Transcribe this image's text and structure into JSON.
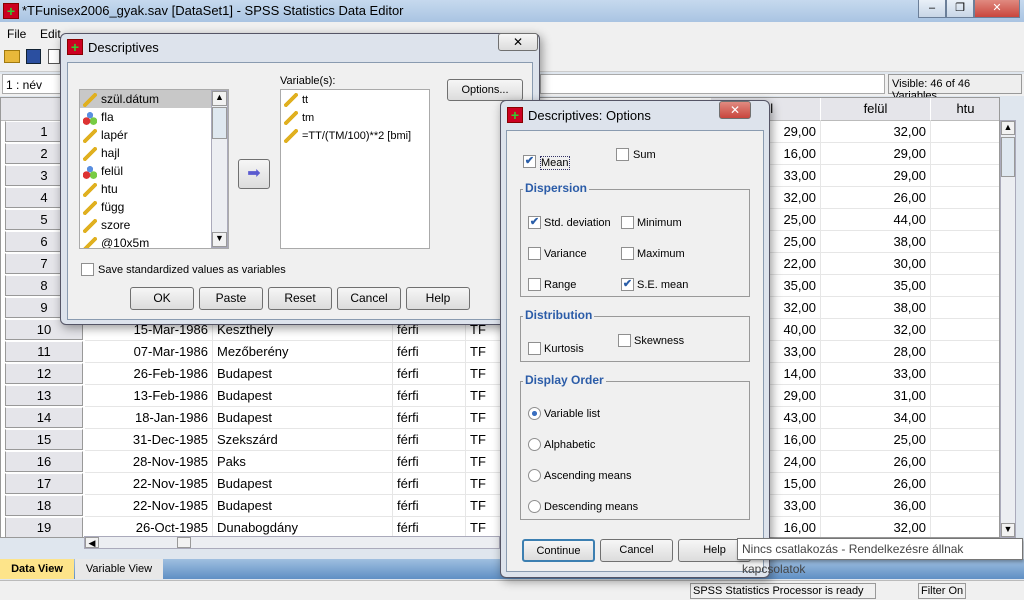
{
  "window": {
    "title": "*TFunisex2006_gyak.sav [DataSet1] - SPSS Statistics Data Editor",
    "minimize": "–",
    "restore": "❐",
    "close": "✕"
  },
  "menu": [
    {
      "label": "File"
    },
    {
      "label": "Edit"
    }
  ],
  "cell_ref": "1 : név",
  "visible_vars": "Visible: 46 of 46 Variables",
  "grid": {
    "headers": [
      "ül",
      "felül",
      "htu"
    ],
    "row_numbers": [
      "1",
      "2",
      "3",
      "4",
      "5",
      "6",
      "7",
      "8",
      "9",
      "10",
      "11",
      "12",
      "13",
      "14",
      "15",
      "16",
      "17",
      "18",
      "19"
    ],
    "right_cols": [
      [
        "29,00",
        "32,00"
      ],
      [
        "16,00",
        "29,00"
      ],
      [
        "33,00",
        "29,00"
      ],
      [
        "32,00",
        "26,00"
      ],
      [
        "25,00",
        "44,00"
      ],
      [
        "25,00",
        "38,00"
      ],
      [
        "22,00",
        "30,00"
      ],
      [
        "35,00",
        "35,00"
      ],
      [
        "32,00",
        "38,00"
      ],
      [
        "40,00",
        "32,00"
      ],
      [
        "33,00",
        "28,00"
      ],
      [
        "14,00",
        "33,00"
      ],
      [
        "29,00",
        "31,00"
      ],
      [
        "43,00",
        "34,00"
      ],
      [
        "16,00",
        "25,00"
      ],
      [
        "24,00",
        "26,00"
      ],
      [
        "15,00",
        "26,00"
      ],
      [
        "33,00",
        "36,00"
      ],
      [
        "16,00",
        "32,00"
      ]
    ],
    "left_rows": [
      [
        "15-Mar-1986",
        "Keszthely",
        "férfi",
        "TF"
      ],
      [
        "07-Mar-1986",
        "Mezőberény",
        "férfi",
        "TF"
      ],
      [
        "26-Feb-1986",
        "Budapest",
        "férfi",
        "TF"
      ],
      [
        "13-Feb-1986",
        "Budapest",
        "férfi",
        "TF"
      ],
      [
        "18-Jan-1986",
        "Budapest",
        "férfi",
        "TF"
      ],
      [
        "31-Dec-1985",
        "Szekszárd",
        "férfi",
        "TF"
      ],
      [
        "28-Nov-1985",
        "Paks",
        "férfi",
        "TF"
      ],
      [
        "22-Nov-1985",
        "Budapest",
        "férfi",
        "TF"
      ],
      [
        "22-Nov-1985",
        "Budapest",
        "férfi",
        "TF"
      ],
      [
        "26-Oct-1985",
        "Dunabogdány",
        "férfi",
        "TF"
      ]
    ]
  },
  "tabs": [
    {
      "label": "Data View",
      "active": true
    },
    {
      "label": "Variable View",
      "active": false
    }
  ],
  "status": {
    "processor": "SPSS Statistics  Processor is ready",
    "filter": "Filter On"
  },
  "tooltip": "Nincs csatlakozás - Rendelkezésre állnak kapcsolatok",
  "descriptives": {
    "title": "Descriptives",
    "close": "✕",
    "source_vars": [
      {
        "name": "szül.dátum",
        "icon": "date"
      },
      {
        "name": "fla",
        "icon": "nominal"
      },
      {
        "name": "lapér",
        "icon": "scale"
      },
      {
        "name": "hajl",
        "icon": "scale"
      },
      {
        "name": "felül",
        "icon": "nominal"
      },
      {
        "name": "htu",
        "icon": "scale"
      },
      {
        "name": "függ",
        "icon": "scale"
      },
      {
        "name": "szore",
        "icon": "scale"
      },
      {
        "name": "@10x5m",
        "icon": "scale"
      }
    ],
    "variables_label": "Variable(s):",
    "selected_vars": [
      {
        "name": "tt"
      },
      {
        "name": "tm"
      },
      {
        "name": "=TT/(TM/100)**2 [bmi]"
      }
    ],
    "options_button": "Options...",
    "save_standardized": {
      "label": "Save standardized values as variables",
      "checked": false
    },
    "buttons": [
      "OK",
      "Paste",
      "Reset",
      "Cancel",
      "Help"
    ]
  },
  "options": {
    "title": "Descriptives: Options",
    "close": "✕",
    "mean": {
      "label": "Mean",
      "checked": true
    },
    "sum": {
      "label": "Sum",
      "checked": false
    },
    "dispersion": {
      "title": "Dispersion",
      "items": [
        {
          "label": "Std. deviation",
          "checked": true
        },
        {
          "label": "Minimum",
          "checked": false
        },
        {
          "label": "Variance",
          "checked": false
        },
        {
          "label": "Maximum",
          "checked": false
        },
        {
          "label": "Range",
          "checked": false
        },
        {
          "label": "S.E. mean",
          "checked": true
        }
      ]
    },
    "distribution": {
      "title": "Distribution",
      "items": [
        {
          "label": "Kurtosis",
          "checked": false
        },
        {
          "label": "Skewness",
          "checked": false
        }
      ]
    },
    "display_order": {
      "title": "Display Order",
      "selected": "Variable list",
      "items": [
        {
          "label": "Variable list"
        },
        {
          "label": "Alphabetic"
        },
        {
          "label": "Ascending means"
        },
        {
          "label": "Descending means"
        }
      ]
    },
    "buttons": [
      "Continue",
      "Cancel",
      "Help"
    ]
  },
  "colors": {
    "accent": "#2b5ca8",
    "active_tab": "#fde48a",
    "close_red": "#c9463d"
  }
}
